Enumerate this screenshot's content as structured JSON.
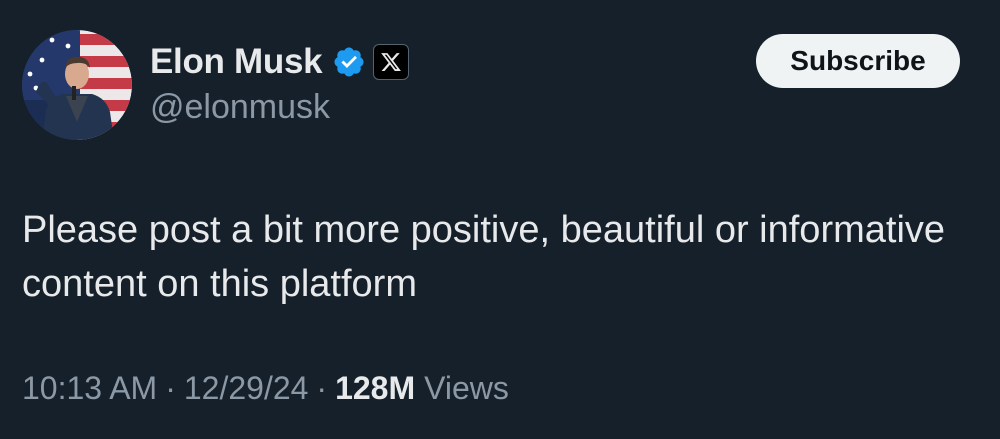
{
  "user": {
    "display_name": "Elon Musk",
    "handle": "@elonmusk",
    "verified_icon": "verified-badge-icon",
    "affiliation_icon": "x-logo-icon"
  },
  "subscribe_label": "Subscribe",
  "tweet": {
    "text": "Please post a bit more positive, beautiful or informative content on this platform"
  },
  "meta": {
    "time": "10:13 AM",
    "separator": "·",
    "date": "12/29/24",
    "views_count": "128M",
    "views_label": "Views"
  },
  "colors": {
    "background": "#15202b",
    "text_primary": "#e7e9ea",
    "text_secondary": "#8b98a5",
    "verified_blue": "#1d9bf0",
    "button_bg": "#eff3f4"
  }
}
